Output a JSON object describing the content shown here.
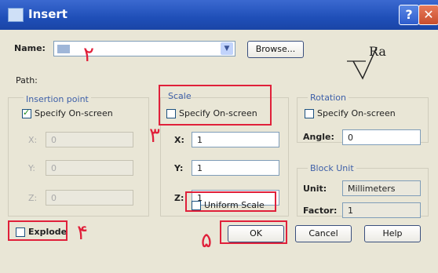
{
  "window": {
    "title": "Insert"
  },
  "name_row": {
    "label": "Name:",
    "value": "",
    "browse_label": "Browse..."
  },
  "path_label": "Path:",
  "insertion_point": {
    "group_label": "Insertion point",
    "specify_label": "Specify On-screen",
    "specify_checked": true,
    "x_label": "X:",
    "y_label": "Y:",
    "z_label": "Z:",
    "x_value": "0",
    "y_value": "0",
    "z_value": "0"
  },
  "scale": {
    "group_label": "Scale",
    "specify_label": "Specify On-screen",
    "specify_checked": false,
    "x_label": "X:",
    "y_label": "Y:",
    "z_label": "Z:",
    "x_value": "1",
    "y_value": "1",
    "z_value": "1",
    "uniform_label": "Uniform Scale",
    "uniform_checked": false
  },
  "rotation": {
    "group_label": "Rotation",
    "specify_label": "Specify On-screen",
    "specify_checked": false,
    "angle_label": "Angle:",
    "angle_value": "0"
  },
  "block_unit": {
    "group_label": "Block Unit",
    "unit_label": "Unit:",
    "unit_value": "Millimeters",
    "factor_label": "Factor:",
    "factor_value": "1"
  },
  "explode": {
    "label": "Explode",
    "checked": false
  },
  "buttons": {
    "ok": "OK",
    "cancel": "Cancel",
    "help": "Help"
  },
  "preview_text": "Ra",
  "annotations": {
    "n2": "۲",
    "n3": "۳",
    "n4": "۴",
    "n5": "۵"
  },
  "colors": {
    "title_bar": "#2457c5",
    "annotation_red": "#e0203a",
    "dialog_bg": "#e9e6d6"
  }
}
